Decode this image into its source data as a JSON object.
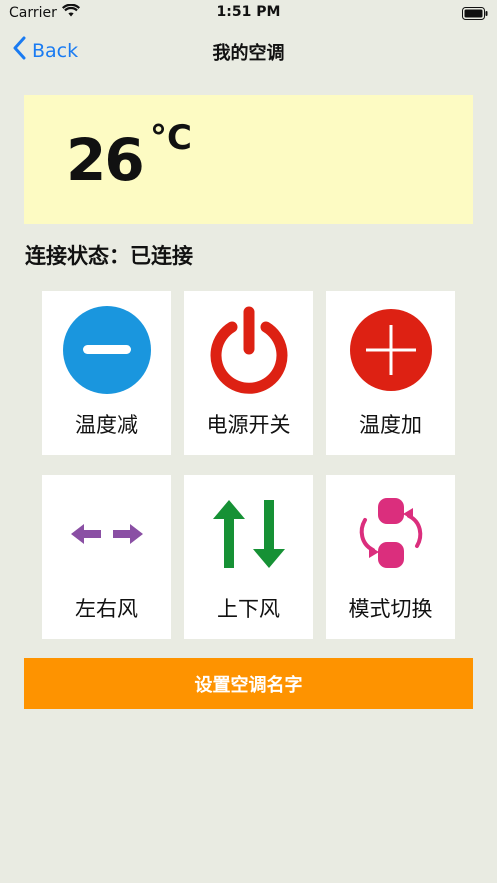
{
  "status_bar": {
    "carrier": "Carrier",
    "time": "1:51 PM"
  },
  "nav": {
    "back_label": "Back",
    "title": "我的空调"
  },
  "temperature": {
    "value": "26",
    "unit": "°C"
  },
  "connection": {
    "text": "连接状态：已连接"
  },
  "controls": [
    {
      "label": "温度减",
      "icon": "minus-circle-icon",
      "color": "#1a96de"
    },
    {
      "label": "电源开关",
      "icon": "power-icon",
      "color": "#dd2113"
    },
    {
      "label": "温度加",
      "icon": "plus-circle-icon",
      "color": "#dd2113"
    },
    {
      "label": "左右风",
      "icon": "left-right-arrows-icon",
      "color": "#8a4fa4"
    },
    {
      "label": "上下风",
      "icon": "up-down-arrows-icon",
      "color": "#169135"
    },
    {
      "label": "模式切换",
      "icon": "mode-cycle-icon",
      "color": "#db2e7d"
    }
  ],
  "name_button": {
    "label": "设置空调名字",
    "color": "#fe9300"
  }
}
